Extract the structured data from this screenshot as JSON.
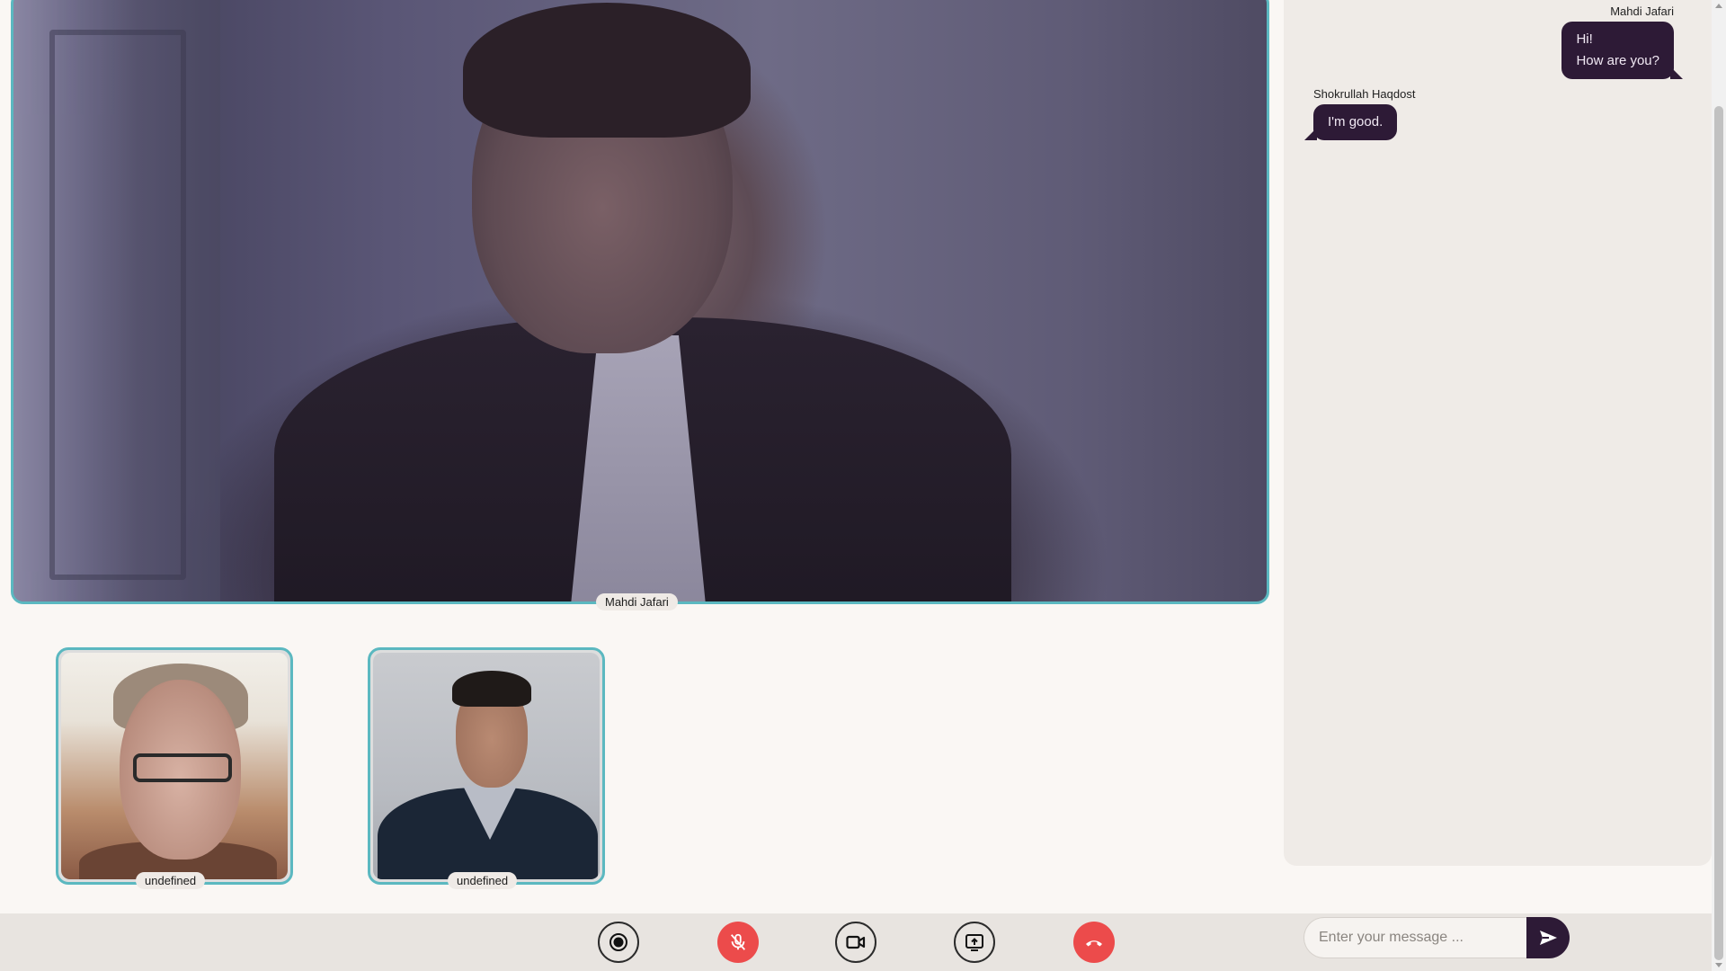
{
  "main_video": {
    "participant_name": "Mahdi Jafari"
  },
  "thumbnails": [
    {
      "participant_name": "undefined"
    },
    {
      "participant_name": "undefined"
    }
  ],
  "chat": {
    "messages": [
      {
        "author": "Mahdi Jafari",
        "lines": [
          "Hi!",
          "How are you?"
        ],
        "side": "right"
      },
      {
        "author": "Shokrullah Haqdost",
        "lines": [
          "I'm good."
        ],
        "side": "left"
      }
    ],
    "input_placeholder": "Enter your message ..."
  },
  "controls": {
    "buttons": [
      {
        "name": "record",
        "icon": "record-icon",
        "style": "outline"
      },
      {
        "name": "mute-microphone",
        "icon": "microphone-off-icon",
        "style": "red"
      },
      {
        "name": "toggle-camera",
        "icon": "video-camera-icon",
        "style": "outline"
      },
      {
        "name": "share-screen",
        "icon": "screen-share-icon",
        "style": "outline"
      },
      {
        "name": "end-call",
        "icon": "phone-hangup-icon",
        "style": "red"
      }
    ]
  },
  "colors": {
    "accent_border": "#5bb8c0",
    "bubble": "#2d1a36",
    "danger": "#ec4b4b",
    "control_bar": "#e8e4e0",
    "chat_panel": "#efebe7"
  }
}
